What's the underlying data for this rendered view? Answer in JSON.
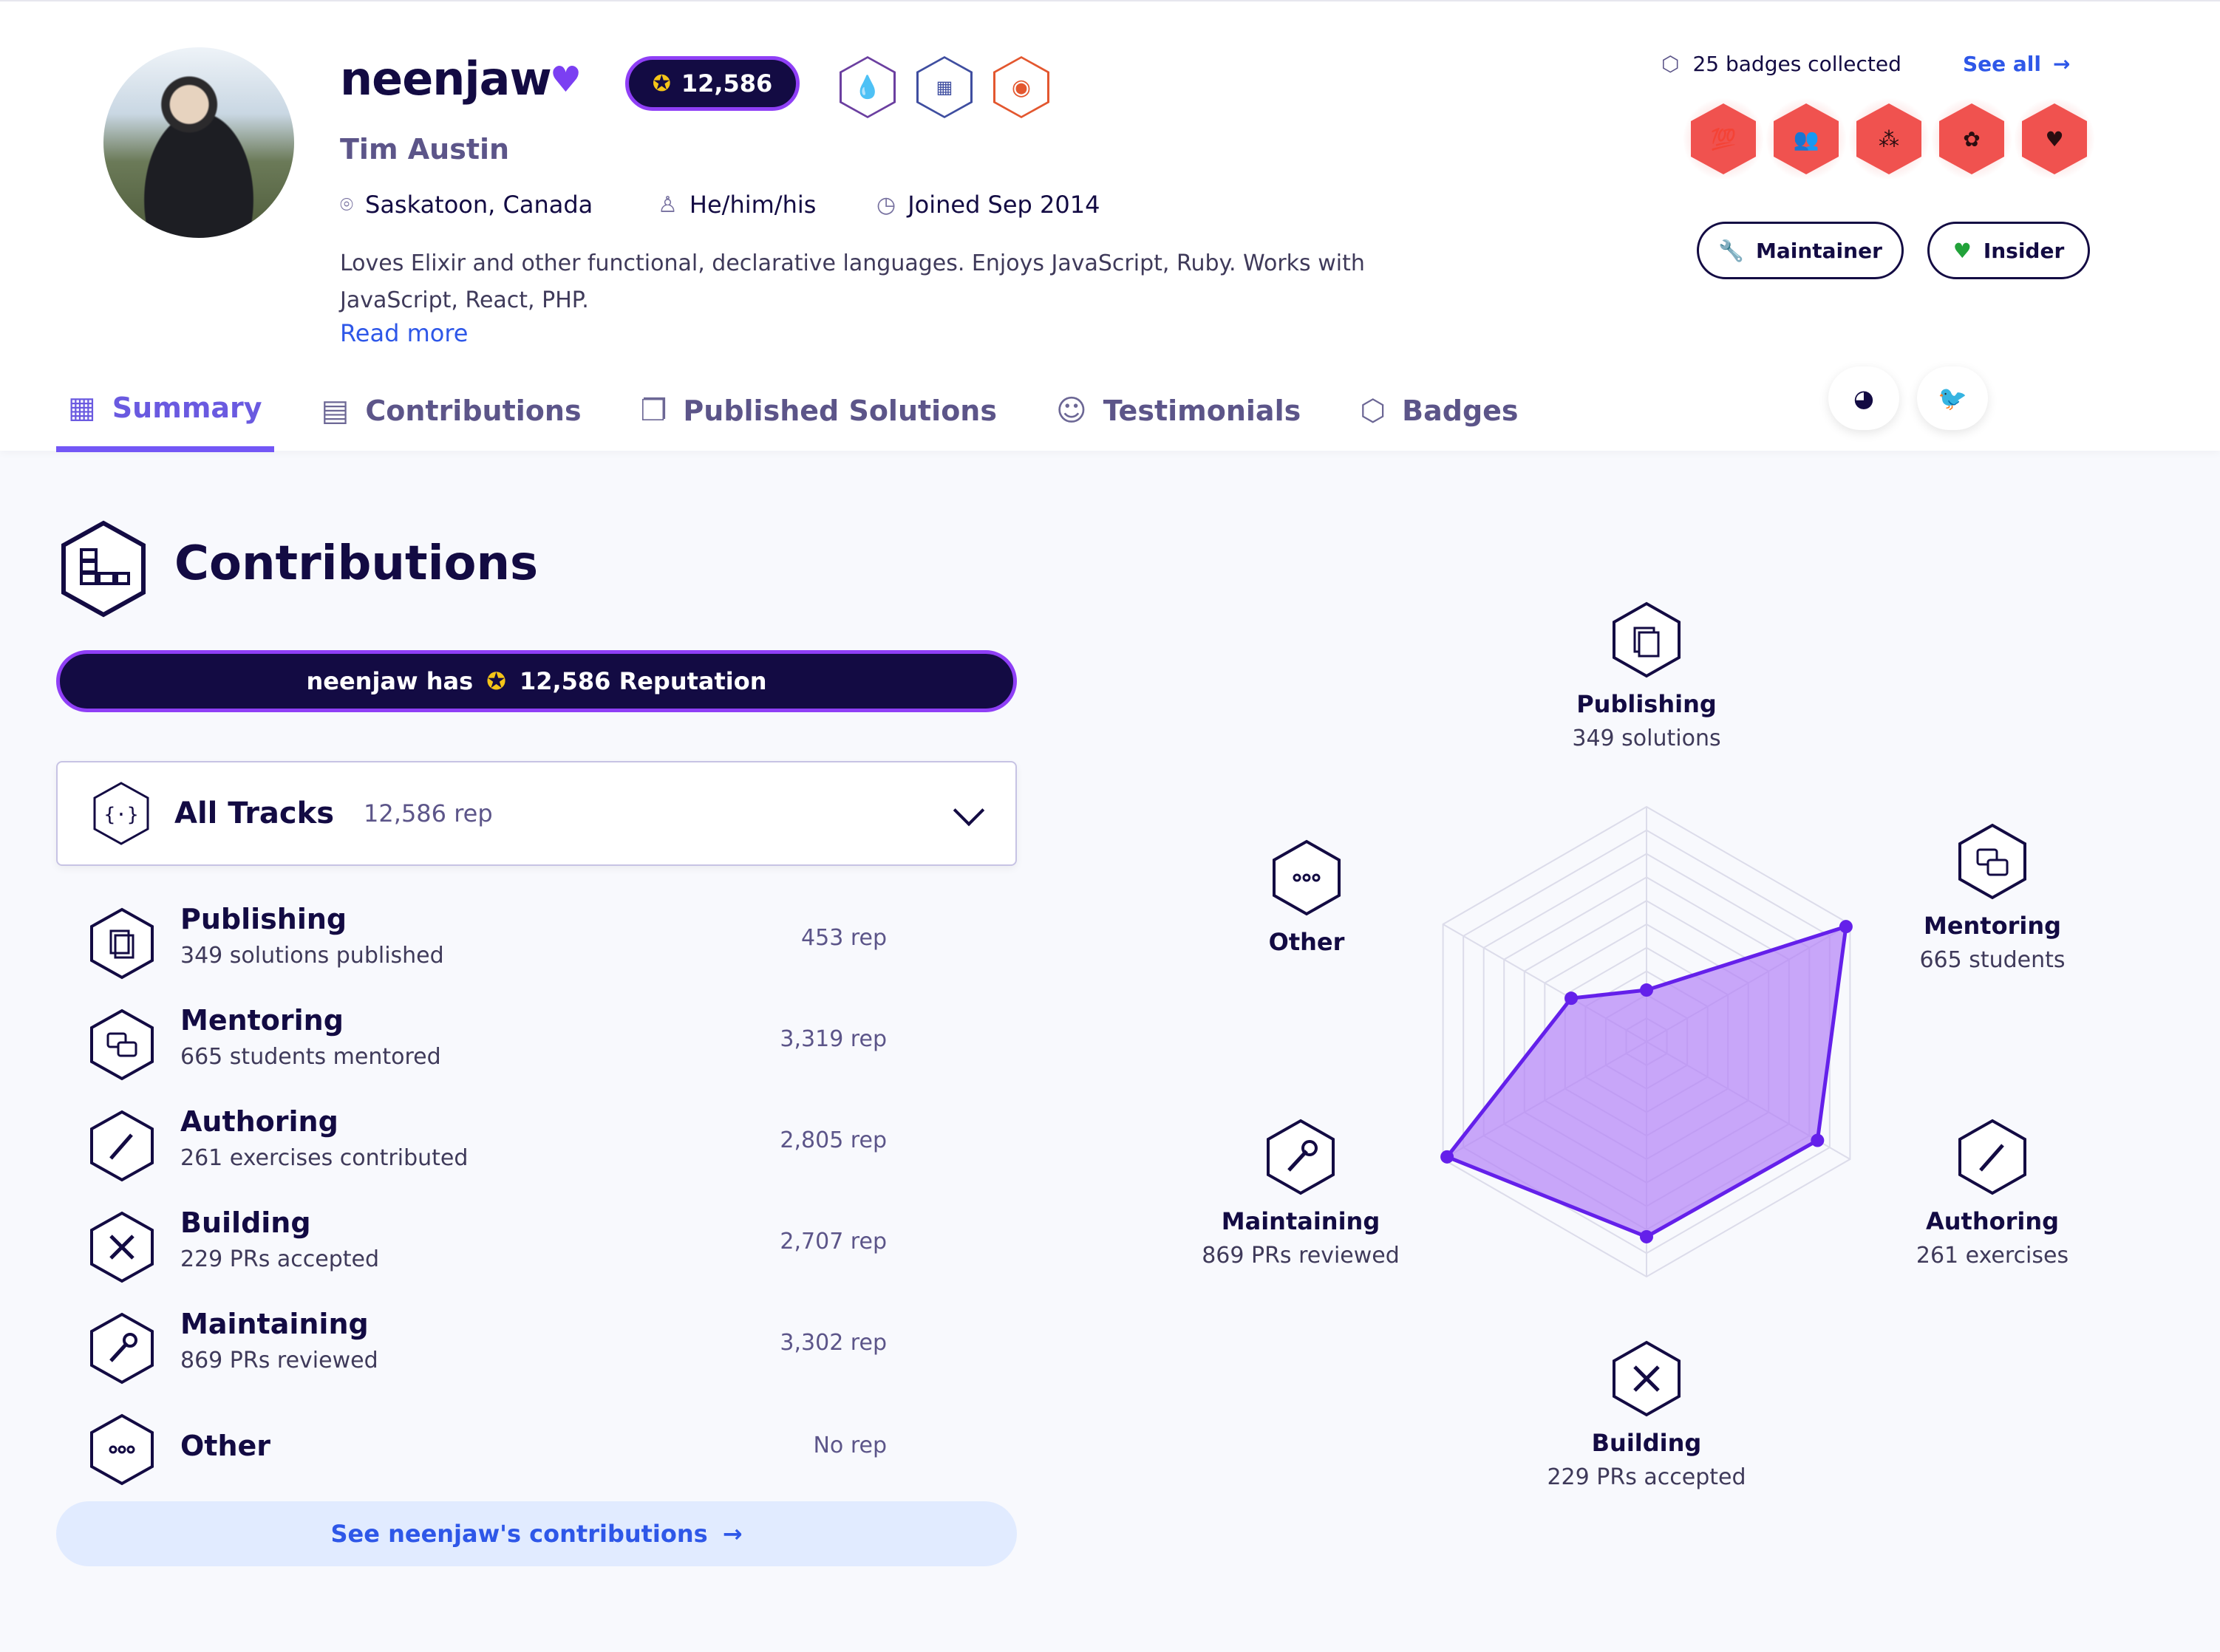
{
  "profile": {
    "username": "neenjaw",
    "name": "Tim Austin",
    "reputation": "12,586",
    "location": "Saskatoon, Canada",
    "pronouns": "He/him/his",
    "joined": "Joined Sep 2014",
    "bio": "Loves Elixir and other functional, declarative languages. Enjoys JavaScript, Ruby. Works with JavaScript, React, PHP.",
    "read_more": "Read more"
  },
  "badges": {
    "summary": "25 badges collected",
    "see_all": "See all",
    "top_icons": [
      "elixir-drop-icon",
      "elephant-icon",
      "owl-icon"
    ],
    "collected_icons": [
      "hundred-icon",
      "people-icon",
      "tree-icon",
      "brain-icon",
      "heart-icon"
    ]
  },
  "roles": [
    "Maintainer",
    "Insider"
  ],
  "tabs": [
    {
      "label": "Summary",
      "active": true
    },
    {
      "label": "Contributions",
      "active": false
    },
    {
      "label": "Published Solutions",
      "active": false
    },
    {
      "label": "Testimonials",
      "active": false
    },
    {
      "label": "Badges",
      "active": false
    }
  ],
  "contributions": {
    "title": "Contributions",
    "banner_prefix": "neenjaw has",
    "banner_rep": "12,586 Reputation",
    "track": {
      "name": "All Tracks",
      "rep": "12,586 rep"
    },
    "categories": [
      {
        "title": "Publishing",
        "subtitle": "349 solutions published",
        "rep": "453 rep"
      },
      {
        "title": "Mentoring",
        "subtitle": "665 students mentored",
        "rep": "3,319 rep"
      },
      {
        "title": "Authoring",
        "subtitle": "261 exercises contributed",
        "rep": "2,805 rep"
      },
      {
        "title": "Building",
        "subtitle": "229 PRs accepted",
        "rep": "2,707 rep"
      },
      {
        "title": "Maintaining",
        "subtitle": "869 PRs reviewed",
        "rep": "3,302 rep"
      },
      {
        "title": "Other",
        "subtitle": "",
        "rep": "No rep"
      }
    ],
    "see_link": "See neenjaw's contributions"
  },
  "radar": {
    "axes": [
      {
        "title": "Publishing",
        "subtitle": "349 solutions",
        "value": 0.22
      },
      {
        "title": "Mentoring",
        "subtitle": "665 students",
        "value": 0.98
      },
      {
        "title": "Authoring",
        "subtitle": "261 exercises",
        "value": 0.84
      },
      {
        "title": "Building",
        "subtitle": "229 PRs accepted",
        "value": 0.83
      },
      {
        "title": "Maintaining",
        "subtitle": "869 PRs reviewed",
        "value": 0.98
      },
      {
        "title": "Other",
        "subtitle": "",
        "value": 0.37
      }
    ]
  },
  "colors": {
    "accent": "#7357f6",
    "navy": "#130b43",
    "link": "#2e57e8",
    "badge_red": "#f0524f",
    "radar_fill": "#b685f7"
  }
}
